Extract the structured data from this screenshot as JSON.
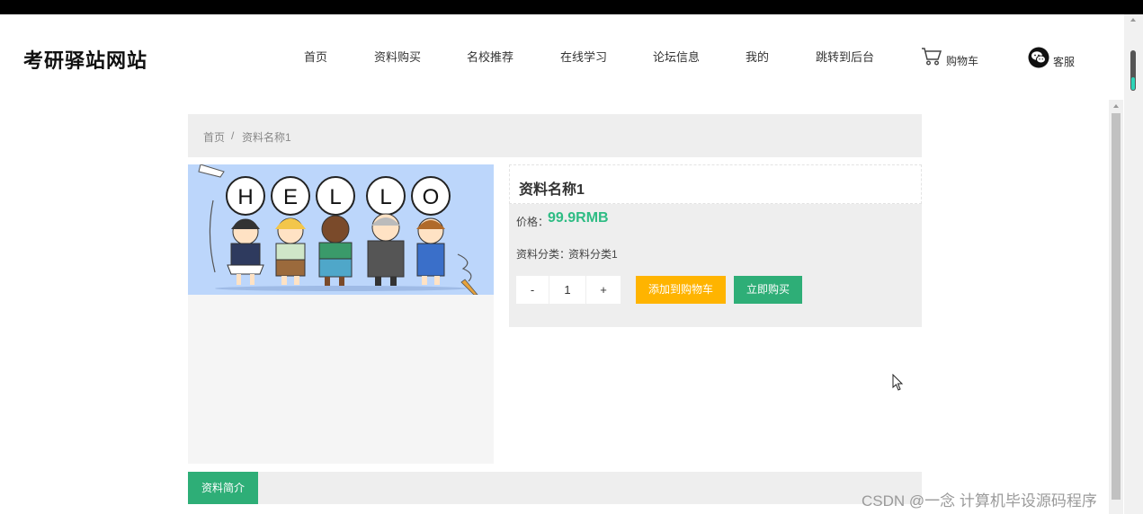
{
  "site": {
    "title": "考研驿站网站"
  },
  "nav": {
    "items": [
      "首页",
      "资料购买",
      "名校推荐",
      "在线学习",
      "论坛信息",
      "我的",
      "跳转到后台"
    ],
    "cart_label": "购物车",
    "service_label": "客服",
    "cart_icon": "cart-icon",
    "service_icon": "wechat-icon"
  },
  "breadcrumb": {
    "home": "首页",
    "sep": "/",
    "current": "资料名称1"
  },
  "hero_image": {
    "letters": [
      "H",
      "E",
      "L",
      "L",
      "O"
    ]
  },
  "product": {
    "name": "资料名称1",
    "price_label": "价格：",
    "price": "99.9RMB",
    "category_label": "资料分类：",
    "category": "资料分类1",
    "quantity_minus": "-",
    "quantity": "1",
    "quantity_plus": "+",
    "add_to_cart": "添加到购物车",
    "buy_now": "立即购买"
  },
  "tabs": {
    "intro": "资料简介"
  },
  "watermark": "CSDN @一念 计算机毕设源码程序",
  "colors": {
    "accent": "#2eae77",
    "price": "#2ebc84",
    "cart_button": "#ffb400"
  }
}
